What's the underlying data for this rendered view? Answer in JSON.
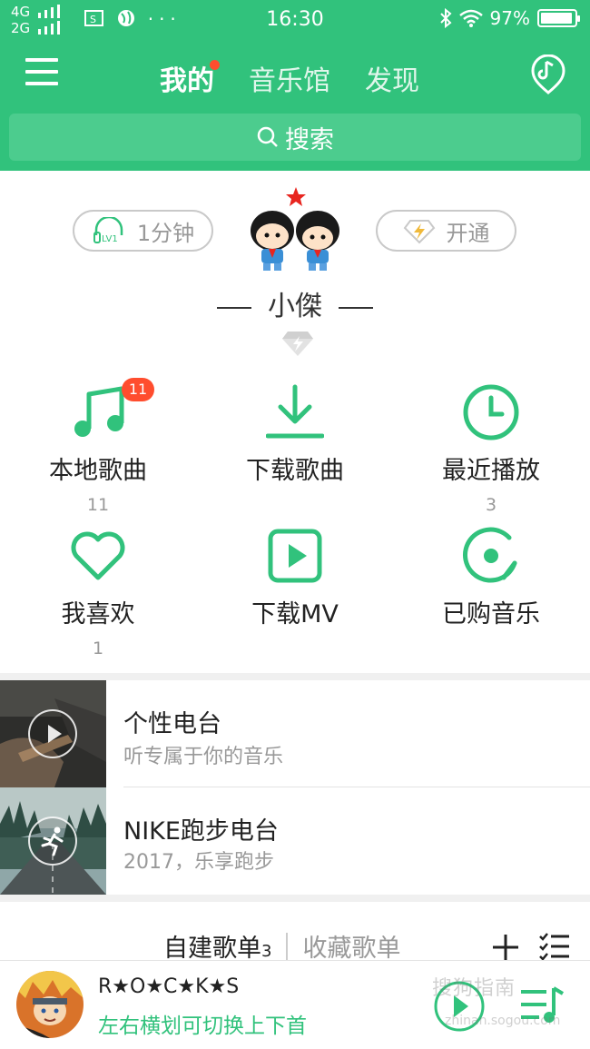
{
  "status_bar": {
    "network_top": "4G",
    "network_bottom": "2G",
    "more": "···",
    "time": "16:30",
    "battery": "97%"
  },
  "nav": {
    "tabs": [
      {
        "label": "我的",
        "active": true,
        "has_dot": true
      },
      {
        "label": "音乐馆",
        "active": false
      },
      {
        "label": "发现",
        "active": false
      }
    ]
  },
  "search": {
    "label": "搜索"
  },
  "profile": {
    "listen_time": "1分钟",
    "level_icon_text": "LV1",
    "vip_button": "开通",
    "username": "小傑"
  },
  "grid": [
    {
      "label": "本地歌曲",
      "count": "11",
      "badge": "11",
      "icon": "music-note-icon"
    },
    {
      "label": "下载歌曲",
      "count": "",
      "icon": "download-icon"
    },
    {
      "label": "最近播放",
      "count": "3",
      "icon": "clock-icon"
    },
    {
      "label": "我喜欢",
      "count": "1",
      "icon": "heart-icon"
    },
    {
      "label": "下载MV",
      "count": "",
      "icon": "video-play-icon"
    },
    {
      "label": "已购音乐",
      "count": "",
      "icon": "disc-icon"
    }
  ],
  "radios": [
    {
      "title": "个性电台",
      "subtitle": "听专属于你的音乐",
      "icon": "play-icon"
    },
    {
      "title": "NIKE跑步电台",
      "subtitle": "2017，乐享跑步",
      "icon": "runner-icon"
    }
  ],
  "playlists": {
    "created_label": "自建歌单",
    "created_count": "3",
    "collected_label": "收藏歌单"
  },
  "mini_player": {
    "title": "R★O★C★K★S",
    "hint": "左右横划可切换上下首",
    "watermark": "搜狗指南",
    "watermark_url": "zhinan.sogou.com"
  },
  "colors": {
    "accent": "#31c27c",
    "badge": "#ff4d2e"
  }
}
